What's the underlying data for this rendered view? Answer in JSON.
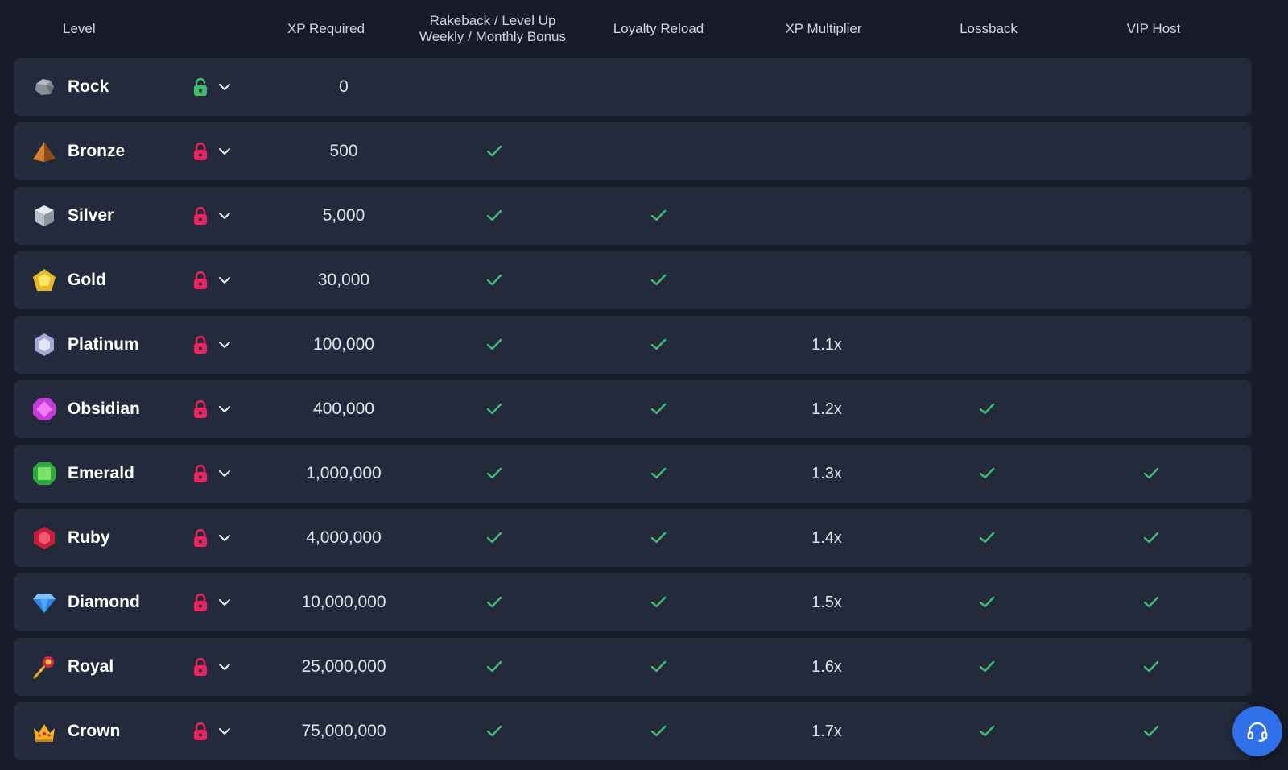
{
  "header": {
    "level": "Level",
    "xp_required": "XP Required",
    "rakeback_line1": "Rakeback / Level Up",
    "rakeback_line2": "Weekly / Monthly Bonus",
    "loyalty_reload": "Loyalty Reload",
    "xp_multiplier": "XP Multiplier",
    "lossback": "Lossback",
    "vip_host": "VIP Host"
  },
  "colors": {
    "background": "#171c28",
    "row": "#232a3b",
    "check": "#3fbf6a",
    "lock_locked": "#e8265b",
    "lock_unlocked": "#3fbf6a",
    "support_button": "#2f6fe8"
  },
  "levels": [
    {
      "name": "Rock",
      "icon": "rock-icon",
      "xp": "0",
      "locked": false,
      "rakeback": false,
      "reload": false,
      "multiplier": "",
      "lossback": false,
      "vip": false
    },
    {
      "name": "Bronze",
      "icon": "bronze-pyramid-icon",
      "xp": "500",
      "locked": true,
      "rakeback": true,
      "reload": false,
      "multiplier": "",
      "lossback": false,
      "vip": false
    },
    {
      "name": "Silver",
      "icon": "silver-cube-icon",
      "xp": "5,000",
      "locked": true,
      "rakeback": true,
      "reload": true,
      "multiplier": "",
      "lossback": false,
      "vip": false
    },
    {
      "name": "Gold",
      "icon": "gold-pentagon-icon",
      "xp": "30,000",
      "locked": true,
      "rakeback": true,
      "reload": true,
      "multiplier": "",
      "lossback": false,
      "vip": false
    },
    {
      "name": "Platinum",
      "icon": "platinum-hexagon-icon",
      "xp": "100,000",
      "locked": true,
      "rakeback": true,
      "reload": true,
      "multiplier": "1.1x",
      "lossback": false,
      "vip": false
    },
    {
      "name": "Obsidian",
      "icon": "obsidian-gem-icon",
      "xp": "400,000",
      "locked": true,
      "rakeback": true,
      "reload": true,
      "multiplier": "1.2x",
      "lossback": true,
      "vip": false
    },
    {
      "name": "Emerald",
      "icon": "emerald-gem-icon",
      "xp": "1,000,000",
      "locked": true,
      "rakeback": true,
      "reload": true,
      "multiplier": "1.3x",
      "lossback": true,
      "vip": true
    },
    {
      "name": "Ruby",
      "icon": "ruby-gem-icon",
      "xp": "4,000,000",
      "locked": true,
      "rakeback": true,
      "reload": true,
      "multiplier": "1.4x",
      "lossback": true,
      "vip": true
    },
    {
      "name": "Diamond",
      "icon": "diamond-icon",
      "xp": "10,000,000",
      "locked": true,
      "rakeback": true,
      "reload": true,
      "multiplier": "1.5x",
      "lossback": true,
      "vip": true
    },
    {
      "name": "Royal",
      "icon": "royal-scepter-icon",
      "xp": "25,000,000",
      "locked": true,
      "rakeback": true,
      "reload": true,
      "multiplier": "1.6x",
      "lossback": true,
      "vip": true
    },
    {
      "name": "Crown",
      "icon": "crown-icon",
      "xp": "75,000,000",
      "locked": true,
      "rakeback": true,
      "reload": true,
      "multiplier": "1.7x",
      "lossback": true,
      "vip": true
    }
  ],
  "support": {
    "icon": "headset-icon"
  }
}
